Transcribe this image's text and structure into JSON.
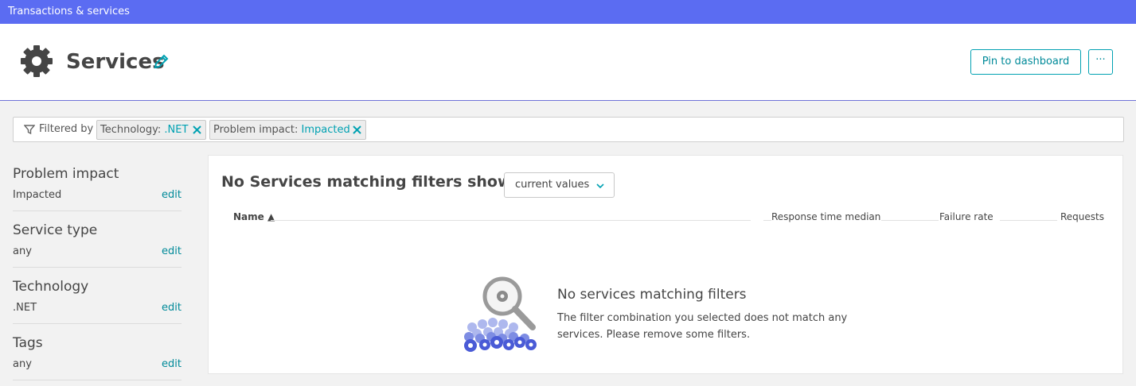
{
  "topbar": {
    "title": "Transactions & services"
  },
  "header": {
    "title": "Services",
    "pin_label": "Pin to dashboard",
    "more_label": "···"
  },
  "filterbar": {
    "label": "Filtered by",
    "chips": [
      {
        "key": "Technology:",
        "value": ".NET"
      },
      {
        "key": "Problem impact:",
        "value": "Impacted"
      }
    ]
  },
  "sidebar": {
    "sections": [
      {
        "title": "Problem impact",
        "value": "Impacted",
        "edit": "edit"
      },
      {
        "title": "Service type",
        "value": "any",
        "edit": "edit"
      },
      {
        "title": "Technology",
        "value": ".NET",
        "edit": "edit"
      },
      {
        "title": "Tags",
        "value": "any",
        "edit": "edit"
      }
    ]
  },
  "panel": {
    "title": "No Services matching filters showing",
    "dropdown_value": "current values",
    "columns": {
      "name": "Name ▲",
      "response": "Response time median",
      "failure": "Failure rate",
      "requests": "Requests"
    },
    "empty_title": "No services matching filters",
    "empty_desc": "The filter combination you selected does not match any services. Please remove some filters."
  },
  "colors": {
    "topbar": "#5b6cf2",
    "accent": "#00a1b2",
    "illustration": "#4a5bd6"
  }
}
